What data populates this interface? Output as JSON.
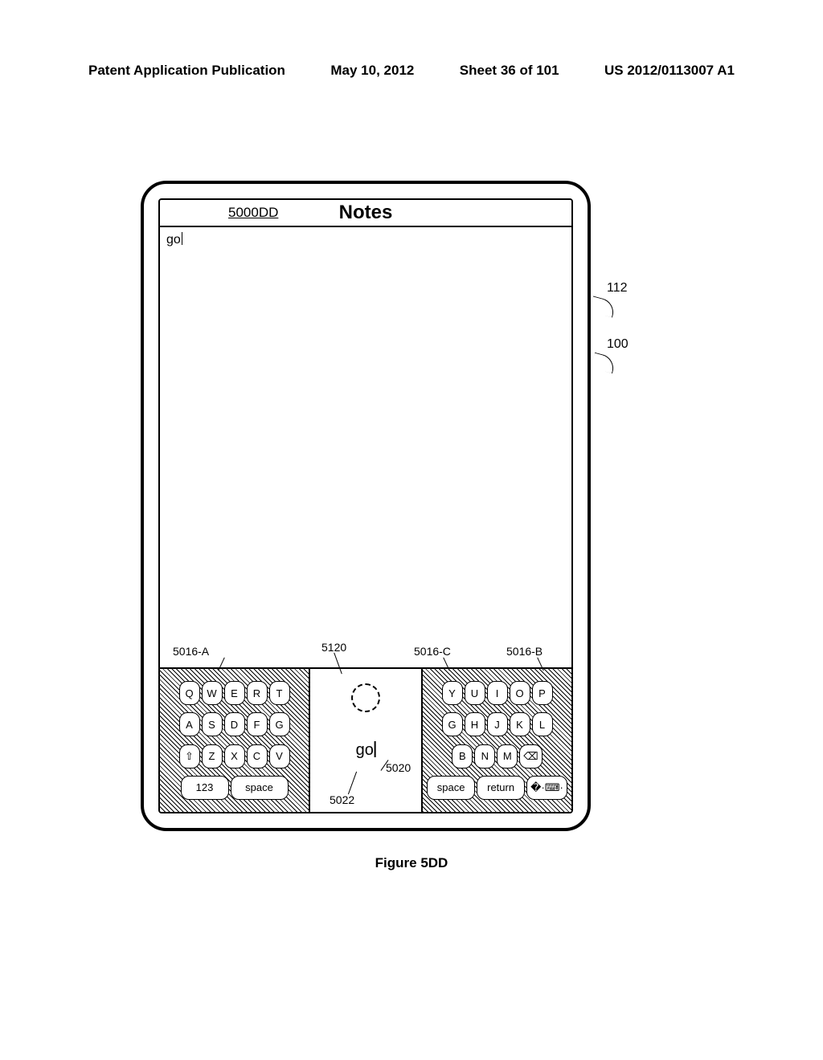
{
  "header": {
    "left": "Patent Application Publication",
    "date": "May 10, 2012",
    "sheet": "Sheet 36 of 101",
    "pubno": "US 2012/0113007 A1"
  },
  "title": "Notes",
  "figure_ref": "5000DD",
  "typed_text": "go",
  "center_text": "go",
  "refs": {
    "r112": "112",
    "r100": "100",
    "k5016a": "5016-A",
    "k5120": "5120",
    "k5016c": "5016-C",
    "k5016b": "5016-B",
    "k5020": "5020",
    "k5022": "5022"
  },
  "keyboard": {
    "left": {
      "rows": [
        [
          "Q",
          "W",
          "E",
          "R",
          "T"
        ],
        [
          "A",
          "S",
          "D",
          "F",
          "G"
        ],
        [
          "⇧",
          "Z",
          "X",
          "C",
          "V"
        ],
        [
          "123",
          "space"
        ]
      ]
    },
    "right": {
      "rows": [
        [
          "Y",
          "U",
          "I",
          "O",
          "P"
        ],
        [
          "G",
          "H",
          "J",
          "K",
          "L"
        ],
        [
          "B",
          "N",
          "M",
          "⌫"
        ],
        [
          "space",
          "return",
          "�·⌨·"
        ]
      ]
    }
  },
  "caption": "Figure 5DD"
}
